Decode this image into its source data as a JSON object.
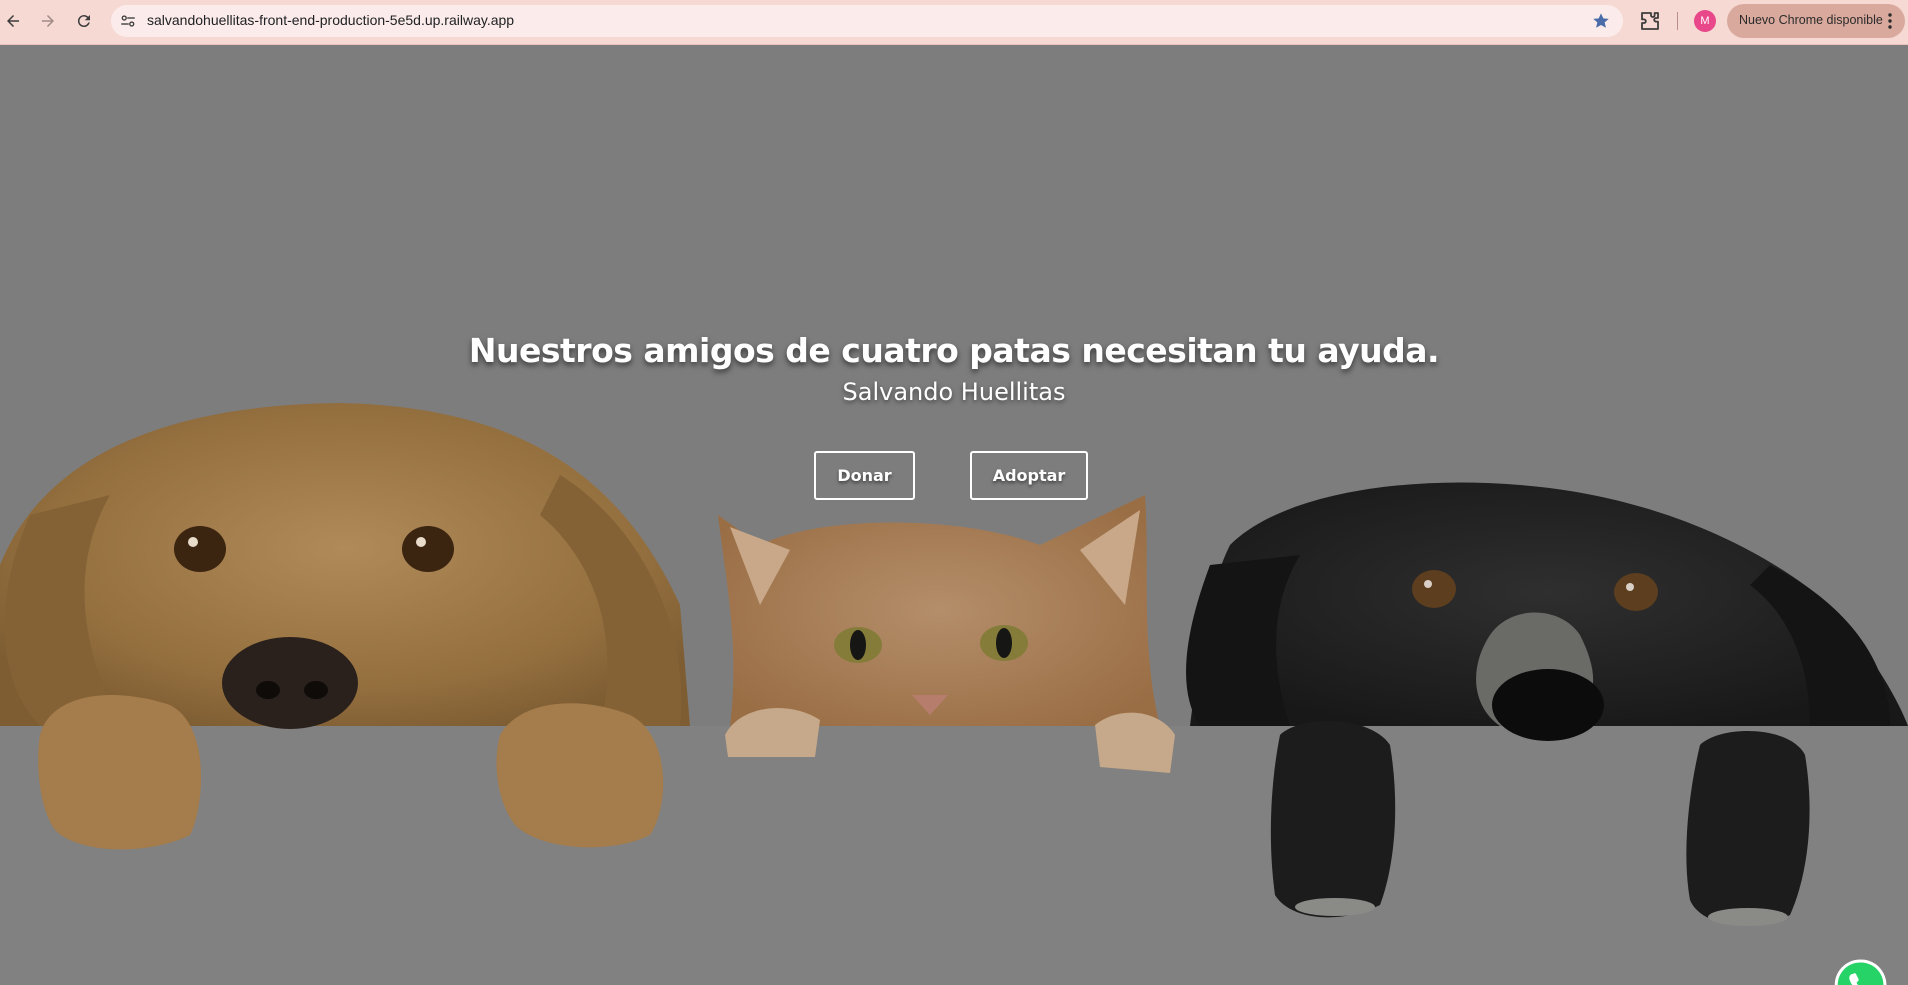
{
  "browser": {
    "url": "salvandohuellitas-front-end-production-5e5d.up.railway.app",
    "update_label": "Nuevo Chrome disponible",
    "avatar_initial": "M"
  },
  "hero": {
    "title": "Nuestros amigos de cuatro patas necesitan tu ayuda.",
    "subtitle": "Salvando Huellitas",
    "buttons": {
      "donate": "Donar",
      "adopt": "Adoptar"
    }
  },
  "colors": {
    "chrome_bg": "#f6d9d3",
    "overlay": "#7d7d7d",
    "whatsapp": "#25d366"
  },
  "icons": [
    "back-icon",
    "forward-icon",
    "reload-icon",
    "site-settings-icon",
    "bookmark-star-icon",
    "extensions-icon",
    "kebab-menu-icon",
    "whatsapp-icon"
  ]
}
